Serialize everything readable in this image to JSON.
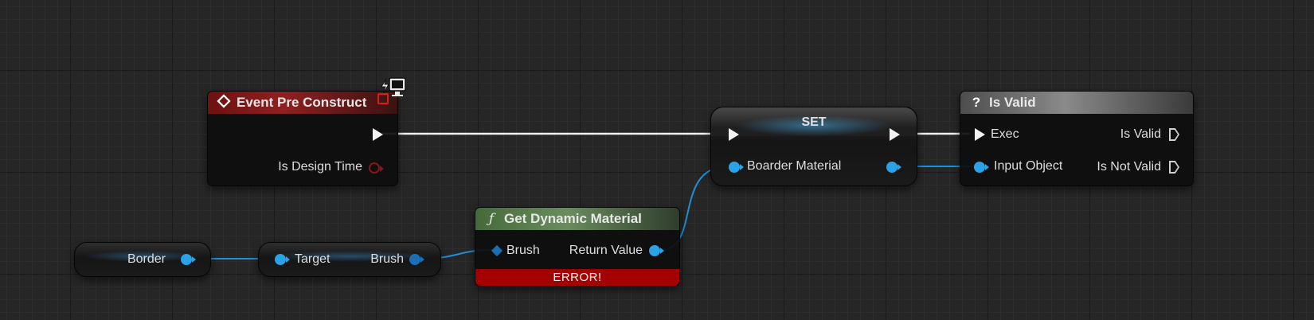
{
  "nodes": {
    "event_pre_construct": {
      "title": "Event Pre Construct",
      "pin_is_design_time": "Is Design Time"
    },
    "set": {
      "title": "SET",
      "pin_variable": "Boarder Material"
    },
    "is_valid": {
      "title": "Is Valid",
      "pin_exec": "Exec",
      "pin_input_object": "Input Object",
      "pin_is_valid": "Is Valid",
      "pin_is_not_valid": "Is Not Valid"
    },
    "border_var": {
      "label": "Border"
    },
    "brush_getter": {
      "pin_target": "Target",
      "pin_brush": "Brush"
    },
    "get_dynamic_material": {
      "title": "Get Dynamic Material",
      "pin_brush": "Brush",
      "pin_return_value": "Return Value",
      "error": "ERROR!"
    }
  },
  "icons": {
    "event": "diamond-event-icon",
    "function": "function-icon",
    "is_valid": "question-mark-icon",
    "editor_only": "monitor-lightning-icon"
  },
  "colors": {
    "background": "#262626",
    "exec_wire": "#f0f0f0",
    "object_wire": "#1f8fd6",
    "event_header": "#8f2020",
    "function_header": "#6a8c5e",
    "macro_header": "#8a8a8a",
    "error": "#a30000"
  }
}
